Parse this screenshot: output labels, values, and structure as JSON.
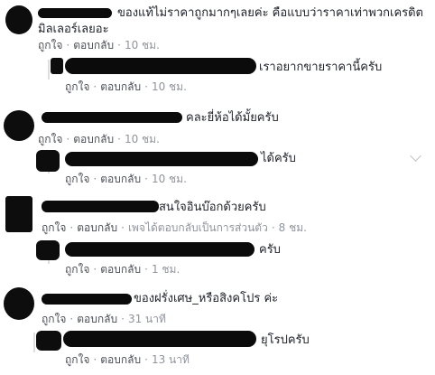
{
  "comments": [
    {
      "text_line1": "ของแท้ไม่ราคาถูกมากๆเลยค่ะ คือแบบว่าราคาเท่าพวกเครดิต",
      "text_line2": "มิลเลอร์เลยอะ",
      "like": "ถูกใจ",
      "reply": "ตอบกลับ",
      "time": "10 ชม."
    },
    {
      "text": "เราอยากขายราคานี้ครับ",
      "like": "ถูกใจ",
      "reply": "ตอบกลับ",
      "time": "10 ชม."
    },
    {
      "text": "คละยี่ห้อได้มั้ยครับ",
      "like": "ถูกใจ",
      "reply": "ตอบกลับ",
      "time": "10 ชม."
    },
    {
      "text": "ได้ครับ",
      "like": "ถูกใจ",
      "reply": "ตอบกลับ",
      "time": "10 ชม."
    },
    {
      "text": "สนใจอินบ๊อกด้วยครับ",
      "like": "ถูกใจ",
      "reply": "ตอบกลับ",
      "private": "เพจได้ตอบกลับเป็นการส่วนตัว",
      "time": "8 ชม."
    },
    {
      "text": "ครับ",
      "like": "ถูกใจ",
      "reply": "ตอบกลับ",
      "time": "1 ชม."
    },
    {
      "text": "ของฝรั่งเศษ_หรือสิงคโปร ค่ะ",
      "like": "ถูกใจ",
      "reply": "ตอบกลับ",
      "time": "31 นาที"
    },
    {
      "text": "ยุโรปครับ",
      "like": "ถูกใจ",
      "reply": "ตอบกลับ",
      "time": "13 นาที"
    }
  ],
  "icons": {
    "more": "chevron-down-icon"
  }
}
